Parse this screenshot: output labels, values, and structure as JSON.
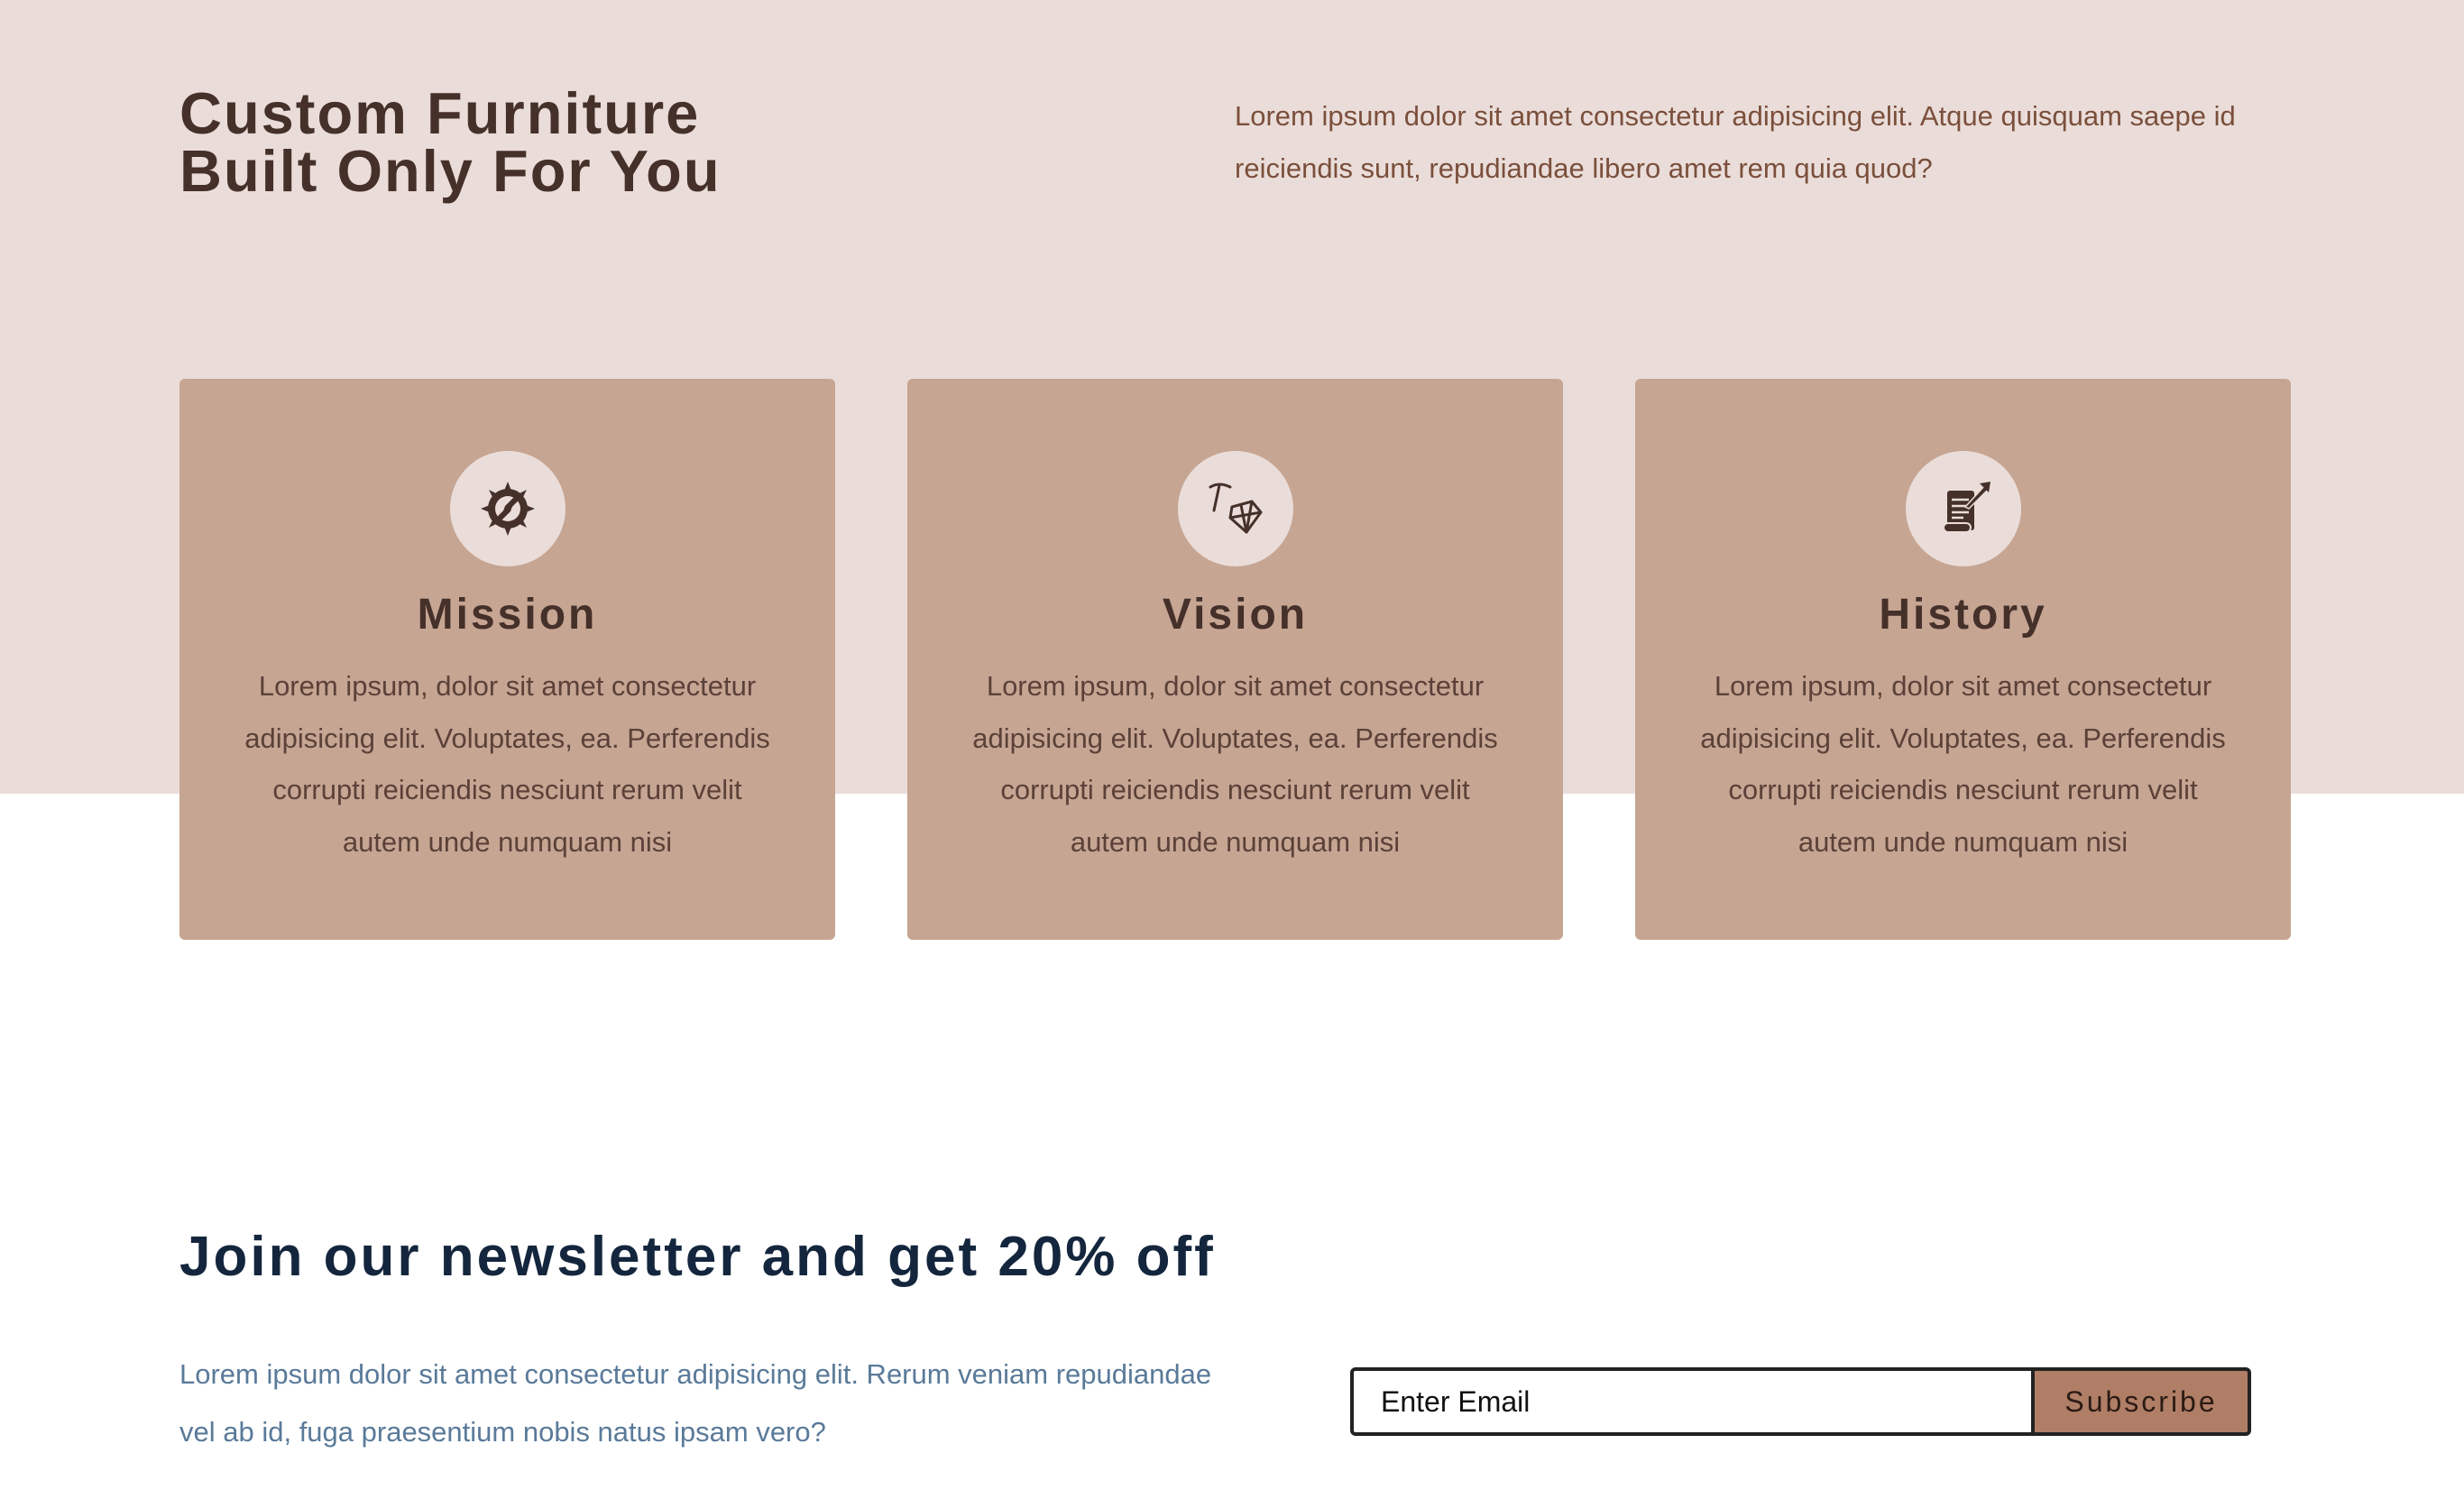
{
  "hero": {
    "title_line1": "Custom Furniture",
    "title_line2": "Built Only For You",
    "description": "Lorem ipsum dolor sit amet consectetur adipisicing elit. Atque quisquam saepe id reiciendis sunt, repudiandae libero amet rem quia quod?"
  },
  "cards": [
    {
      "icon": "compass-icon",
      "title": "Mission",
      "text": "Lorem ipsum, dolor sit amet consectetur adipisicing elit. Voluptates, ea. Perferendis corrupti reiciendis nesciunt rerum velit autem unde numquam nisi"
    },
    {
      "icon": "gem-pickaxe-icon",
      "title": "Vision",
      "text": "Lorem ipsum, dolor sit amet consectetur adipisicing elit. Voluptates, ea. Perferendis corrupti reiciendis nesciunt rerum velit autem unde numquam nisi"
    },
    {
      "icon": "scroll-quill-icon",
      "title": "History",
      "text": "Lorem ipsum, dolor sit amet consectetur adipisicing elit. Voluptates, ea. Perferendis corrupti reiciendis nesciunt rerum velit autem unde numquam nisi"
    }
  ],
  "newsletter": {
    "title": "Join our newsletter and get 20% off",
    "description": "Lorem ipsum dolor sit amet consectetur adipisicing elit. Rerum veniam repudiandae vel ab id, fuga praesentium nobis natus ipsam vero?",
    "email_placeholder": "Enter Email",
    "email_value": "",
    "subscribe_label": "Subscribe"
  },
  "colors": {
    "hero_background": "#eaddd9",
    "card_background": "#c6a593",
    "heading_brown": "#45302a",
    "newsletter_heading": "#14263d",
    "newsletter_text": "#5a7a99",
    "subscribe_button": "#b07e66"
  }
}
